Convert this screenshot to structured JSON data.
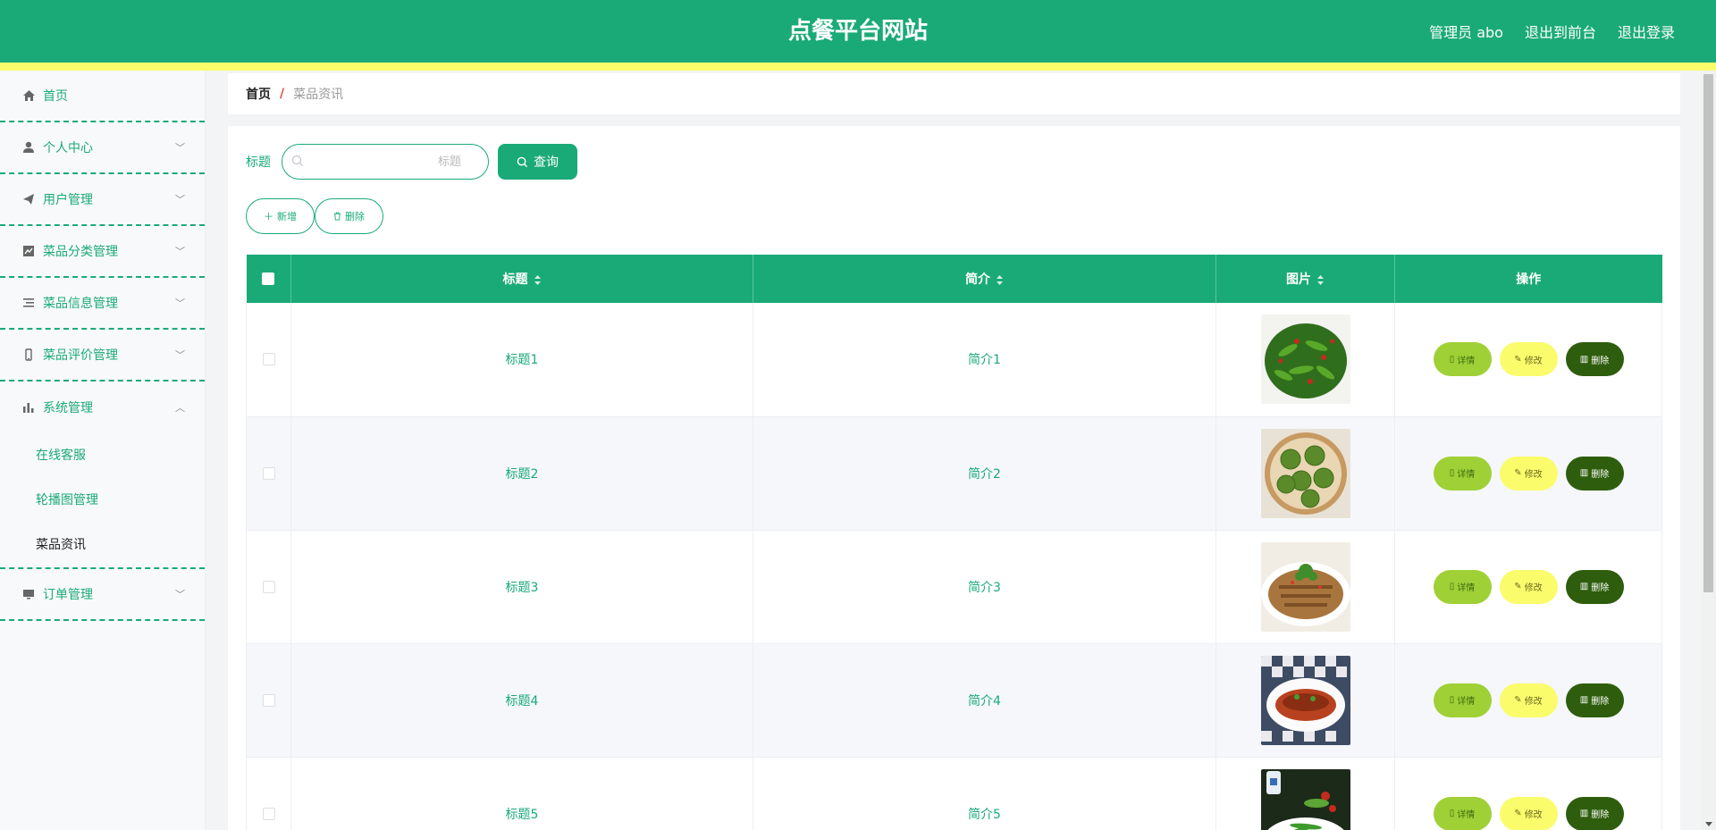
{
  "header": {
    "title": "点餐平台网站",
    "user_label": "管理员 abo",
    "to_front": "退出到前台",
    "logout": "退出登录"
  },
  "colors": {
    "primary": "#1aaa78",
    "stripe": "#fafc6c",
    "detail": "#9fd036",
    "edit": "#fafc6c",
    "delete": "#2e5e0d"
  },
  "sidebar": {
    "items": [
      {
        "label": "首页",
        "icon": "home-icon"
      },
      {
        "label": "个人中心",
        "icon": "user-icon"
      },
      {
        "label": "用户管理",
        "icon": "send-icon"
      },
      {
        "label": "菜品分类管理",
        "icon": "chart-line-icon"
      },
      {
        "label": "菜品信息管理",
        "icon": "list-icon"
      },
      {
        "label": "菜品评价管理",
        "icon": "mobile-icon"
      },
      {
        "label": "系统管理",
        "icon": "bar-chart-icon",
        "expanded": true,
        "children": [
          {
            "label": "在线客服"
          },
          {
            "label": "轮播图管理"
          },
          {
            "label": "菜品资讯",
            "active": true
          }
        ]
      },
      {
        "label": "订单管理",
        "icon": "monitor-icon"
      }
    ]
  },
  "breadcrumb": {
    "home": "首页",
    "separator": "/",
    "current": "菜品资讯"
  },
  "search": {
    "label": "标题",
    "placeholder": "标题",
    "value": "",
    "button": "查询"
  },
  "actions": {
    "add": "新增",
    "delete": "删除"
  },
  "table": {
    "columns": [
      "标题",
      "简介",
      "图片",
      "操作"
    ],
    "rows": [
      {
        "title": "标题1",
        "intro": "简介1"
      },
      {
        "title": "标题2",
        "intro": "简介2"
      },
      {
        "title": "标题3",
        "intro": "简介3"
      },
      {
        "title": "标题4",
        "intro": "简介4"
      },
      {
        "title": "标题5",
        "intro": "简介5"
      }
    ],
    "row_actions": {
      "detail": "详情",
      "edit": "修改",
      "delete": "删除"
    }
  }
}
